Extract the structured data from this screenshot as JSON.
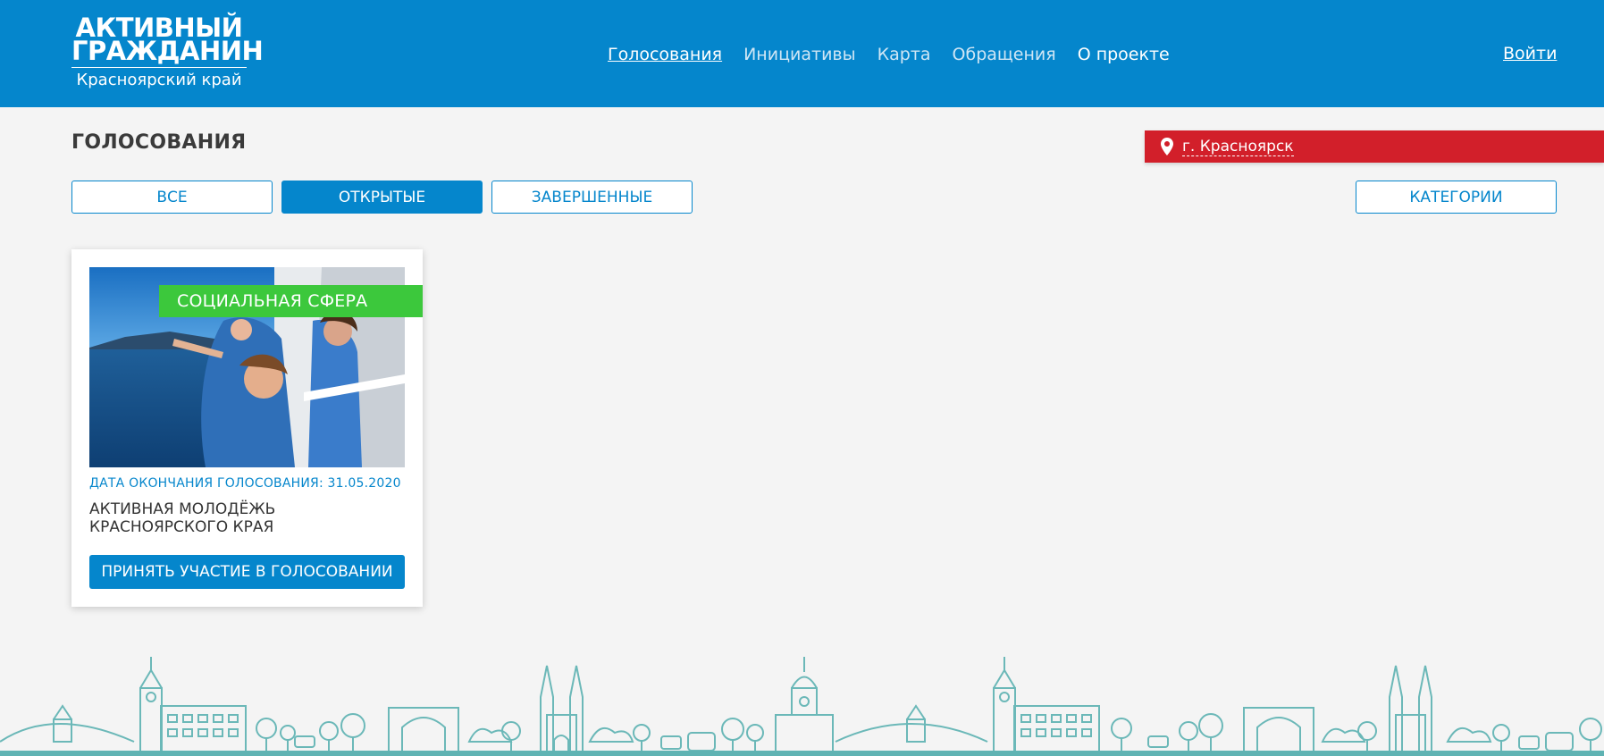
{
  "header": {
    "logo": {
      "line1": "АКТИВНЫЙ",
      "line2": "ГРАЖДАНИН",
      "subtitle": "Красноярский край"
    },
    "nav": [
      {
        "label": "Голосования",
        "active": true
      },
      {
        "label": "Инициативы",
        "active": false
      },
      {
        "label": "Карта",
        "active": false
      },
      {
        "label": "Обращения",
        "active": false
      },
      {
        "label": "О проекте",
        "active": false
      }
    ],
    "login_label": "Войти"
  },
  "page": {
    "title": "ГОЛОСОВАНИЯ",
    "location": {
      "icon": "map-pin-icon",
      "label": "г. Красноярск"
    },
    "filters": [
      {
        "label": "ВСЕ",
        "active": false
      },
      {
        "label": "ОТКРЫТЫЕ",
        "active": true
      },
      {
        "label": "ЗАВЕРШЕННЫЕ",
        "active": false
      }
    ],
    "categories_label": "КАТЕГОРИИ"
  },
  "cards": [
    {
      "category": "СОЦИАЛЬНАЯ СФЕРА",
      "end_date": "ДАТА ОКОНЧАНИЯ ГОЛОСОВАНИЯ: 31.05.2020",
      "title": "АКТИВНАЯ МОЛОДЁЖЬ КРАСНОЯРСКОГО КРАЯ",
      "action_label": "ПРИНЯТЬ УЧАСТИЕ В ГОЛОСОВАНИИ"
    }
  ],
  "colors": {
    "brand_blue": "#0586cc",
    "location_red": "#d21f2a",
    "badge_green": "#3cc83c",
    "skyline_teal": "#5fb3b3"
  }
}
